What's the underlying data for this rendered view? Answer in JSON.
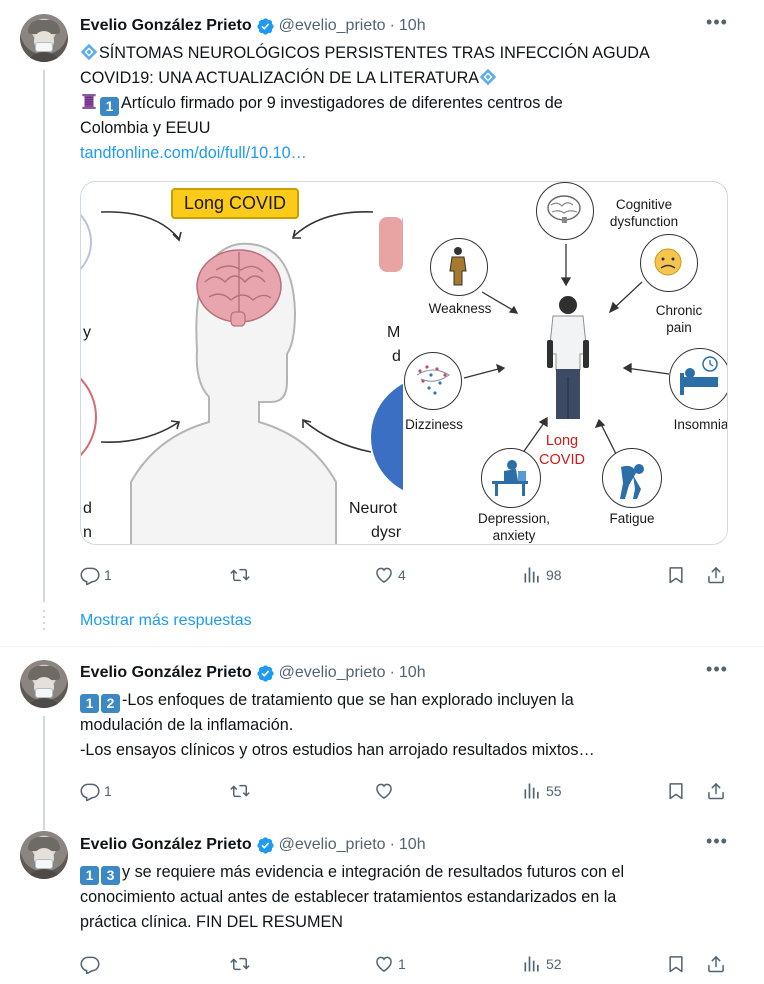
{
  "tweets": [
    {
      "name": "Evelio González Prieto",
      "handle": "@evelio_prieto",
      "time": "10h",
      "lines": [
        "SÍNTOMAS NEUROLÓGICOS PERSISTENTES TRAS INFECCIÓN AGUDA",
        "COVID19: UNA ACTUALIZACIÓN DE LA LITERATURA",
        "Artículo firmado por 9 investigadores de diferentes centros de",
        "Colombia y EEUU"
      ],
      "number_badge": "1",
      "link": "tandfonline.com/doi/full/10.10…",
      "replies": "1",
      "likes": "4",
      "views": "98"
    },
    {
      "name": "Evelio González Prieto",
      "handle": "@evelio_prieto",
      "time": "10h",
      "badges": [
        "1",
        "2"
      ],
      "lines": [
        "-Los enfoques de tratamiento que se han explorado incluyen la",
        "modulación de la inflamación.",
        "-Los ensayos clínicos y otros estudios han arrojado resultados mixtos…"
      ],
      "replies": "1",
      "likes": "",
      "views": "55"
    },
    {
      "name": "Evelio González Prieto",
      "handle": "@evelio_prieto",
      "time": "10h",
      "badges": [
        "1",
        "3"
      ],
      "lines": [
        "y se requiere más evidencia e integración de resultados futuros con el",
        "conocimiento actual antes de establecer tratamientos estandarizados en la",
        "práctica clínica. FIN DEL RESUMEN"
      ],
      "replies": "",
      "likes": "1",
      "views": "52"
    }
  ],
  "show_more_replies": "Mostrar más respuestas",
  "figure_left": {
    "box_label": "Long COVID",
    "fragments": [
      "y",
      "M",
      "d",
      "d",
      "n",
      "Neurot",
      "dysr"
    ]
  },
  "figure_right": {
    "center_label": [
      "Long",
      "COVID"
    ],
    "nodes": {
      "cognitive": [
        "Cognitive",
        "dysfunction"
      ],
      "weakness": "Weakness",
      "chronic_pain": [
        "Chronic",
        "pain"
      ],
      "dizziness": "Dizziness",
      "insomnia": "Insomnia",
      "depression": [
        "Depression,",
        "anxiety"
      ],
      "fatigue": "Fatigue"
    }
  },
  "colors": {
    "link": "#1d9bf0",
    "verified": "#1d9bf0",
    "secondary_text": "#536471",
    "keycap": "#3b88c3",
    "covid_red": "#d11a1a",
    "box_yellow": "#fccb1a"
  },
  "icons": [
    "reply-icon",
    "retweet-icon",
    "like-icon",
    "views-icon",
    "bookmark-icon",
    "share-icon",
    "verified-icon",
    "more-icon"
  ]
}
